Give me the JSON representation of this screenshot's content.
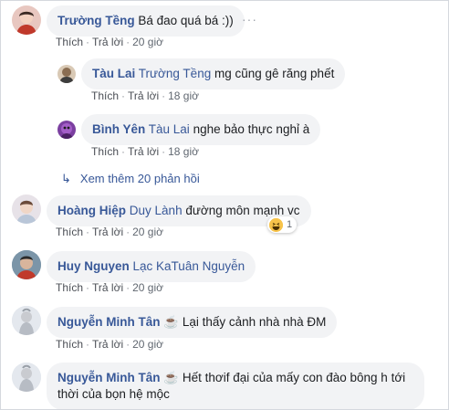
{
  "comments": [
    {
      "author": "Trường Tềng",
      "mention": "",
      "text": "Bá đao quá bá :))",
      "like": "Thích",
      "reply": "Trả lời",
      "time": "20 giờ",
      "more": "···"
    },
    {
      "author": "Tàu Lai",
      "mention": "Trường Tềng",
      "text": "mg cũng gê răng phết",
      "like": "Thích",
      "reply": "Trả lời",
      "time": "18 giờ"
    },
    {
      "author": "Bình Yên",
      "mention": "Tàu Lai",
      "text": "nghe bảo thực nghỉ à",
      "like": "Thích",
      "reply": "Trả lời",
      "time": "18 giờ"
    },
    {
      "author": "Hoàng Hiệp",
      "mention": "Duy Lành",
      "text": "đường môn mạnh vc",
      "like": "Thích",
      "reply": "Trả lời",
      "time": "20 giờ",
      "reaction_count": "1"
    },
    {
      "author": "Huy Nguyen",
      "mention": "Lạc KaTuân Nguyễn",
      "text": "",
      "like": "Thích",
      "reply": "Trả lời",
      "time": "20 giờ"
    },
    {
      "author": "Nguyễn Minh Tân",
      "mention": "",
      "text": "☕ Lại thấy cảnh nhà nhà ĐM",
      "like": "Thích",
      "reply": "Trả lời",
      "time": "20 giờ"
    },
    {
      "author": "Nguyễn Minh Tân",
      "mention": "",
      "text": "☕ Hết thơif đại của mấy con đào bông h tới thời của bọn hệ mộc",
      "like": "",
      "reply": "",
      "time": ""
    }
  ],
  "see_more": "Xem thêm 20 phản hồi"
}
